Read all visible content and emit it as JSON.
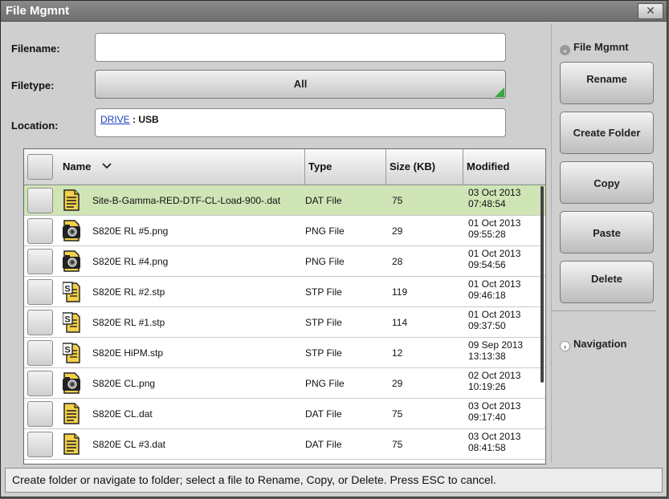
{
  "window": {
    "title": "File Mgmnt",
    "close_label": "✕"
  },
  "form": {
    "filename_label": "Filename:",
    "filename_value": "",
    "filetype_label": "Filetype:",
    "filetype_value": "All",
    "location_label": "Location:",
    "location_link": "DRIVE",
    "location_rest": " : USB"
  },
  "table": {
    "columns": {
      "name": "Name",
      "type": "Type",
      "size": "Size (KB)",
      "modified": "Modified"
    },
    "rows": [
      {
        "name": "Site-B-Gamma-RED-DTF-CL-Load-900-.dat",
        "type": "DAT File",
        "size": "75",
        "date": "03 Oct 2013",
        "time": "07:48:54",
        "icon": "document-icon",
        "selected": true
      },
      {
        "name": "S820E RL #5.png",
        "type": "PNG File",
        "size": "29",
        "date": "01 Oct 2013",
        "time": "09:55:28",
        "icon": "camera-icon",
        "selected": false
      },
      {
        "name": "S820E RL #4.png",
        "type": "PNG File",
        "size": "28",
        "date": "01 Oct 2013",
        "time": "09:54:56",
        "icon": "camera-icon",
        "selected": false
      },
      {
        "name": "S820E RL #2.stp",
        "type": "STP File",
        "size": "119",
        "date": "01 Oct 2013",
        "time": "09:46:18",
        "icon": "setup-file-icon",
        "selected": false
      },
      {
        "name": "S820E RL #1.stp",
        "type": "STP File",
        "size": "114",
        "date": "01 Oct 2013",
        "time": "09:37:50",
        "icon": "setup-file-icon",
        "selected": false
      },
      {
        "name": "S820E HiPM.stp",
        "type": "STP File",
        "size": "12",
        "date": "09 Sep 2013",
        "time": "13:13:38",
        "icon": "setup-file-icon",
        "selected": false
      },
      {
        "name": "S820E CL.png",
        "type": "PNG File",
        "size": "29",
        "date": "02 Oct 2013",
        "time": "10:19:26",
        "icon": "camera-icon",
        "selected": false
      },
      {
        "name": "S820E CL.dat",
        "type": "DAT File",
        "size": "75",
        "date": "03 Oct 2013",
        "time": "09:17:40",
        "icon": "document-icon",
        "selected": false
      },
      {
        "name": "S820E CL #3.dat",
        "type": "DAT File",
        "size": "75",
        "date": "03 Oct 2013",
        "time": "08:41:58",
        "icon": "document-icon",
        "selected": false
      }
    ]
  },
  "sidebar": {
    "section_title": "File Mgmnt",
    "buttons": [
      "Rename",
      "Create Folder",
      "Copy",
      "Paste",
      "Delete"
    ],
    "navigation_label": "Navigation"
  },
  "status_text": "Create folder or navigate to folder; select a file to Rename, Copy, or Delete. Press ESC to cancel.",
  "colors": {
    "selected_row": "#cfe5b6",
    "accent_green": "#3aa83a",
    "link_blue": "#1a3fc2"
  }
}
